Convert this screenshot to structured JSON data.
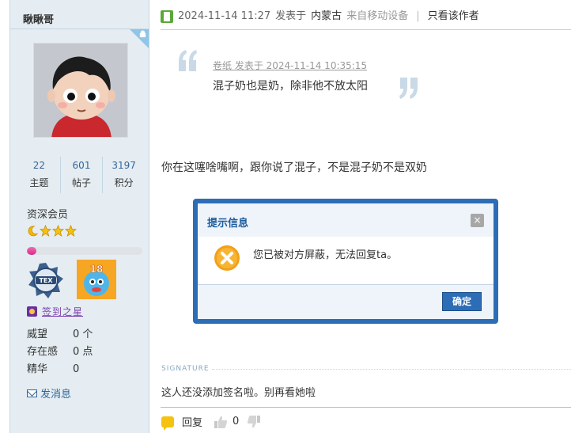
{
  "user": {
    "name": "瞅瞅哥",
    "stats": [
      {
        "value": "22",
        "label": "主题"
      },
      {
        "value": "601",
        "label": "帖子"
      },
      {
        "value": "3197",
        "label": "积分"
      }
    ],
    "rank": "资深会员",
    "group_name": "签到之星",
    "credit_progress": 0.08,
    "info": [
      {
        "key": "威望",
        "value": "0 个"
      },
      {
        "key": "存在感",
        "value": "0 点"
      },
      {
        "key": "精华",
        "value": "0"
      }
    ],
    "pm_label": "发消息",
    "medal_number": "18"
  },
  "post": {
    "time": "2024-11-14 11:27",
    "published_prefix": "发表于",
    "location": "内蒙古",
    "from_device": "来自移动设备",
    "only_author": "只看该作者",
    "quote": {
      "meta": "卷纸 发表于 2024-11-14 10:35:15",
      "text": "混子奶也是奶，除非他不放太阳"
    },
    "body": "你在这噻啥嘴啊，跟你说了混子，不是混子奶不是双奶",
    "signature_label": "SIGNATURE",
    "signature": "这人还没添加签名啦。别再看她啦"
  },
  "dialog": {
    "title": "提示信息",
    "close": "×",
    "message": "您已被对方屏蔽，无法回复ta。",
    "ok": "确定"
  },
  "actions": {
    "reply": "回复",
    "likes": "0"
  },
  "colors": {
    "sidebar_bg": "#e5edf2",
    "link": "#336699",
    "dialog_border": "#2d6db5",
    "credit_fill": "#e0449f",
    "quote_mark": "#c9d9e8"
  }
}
